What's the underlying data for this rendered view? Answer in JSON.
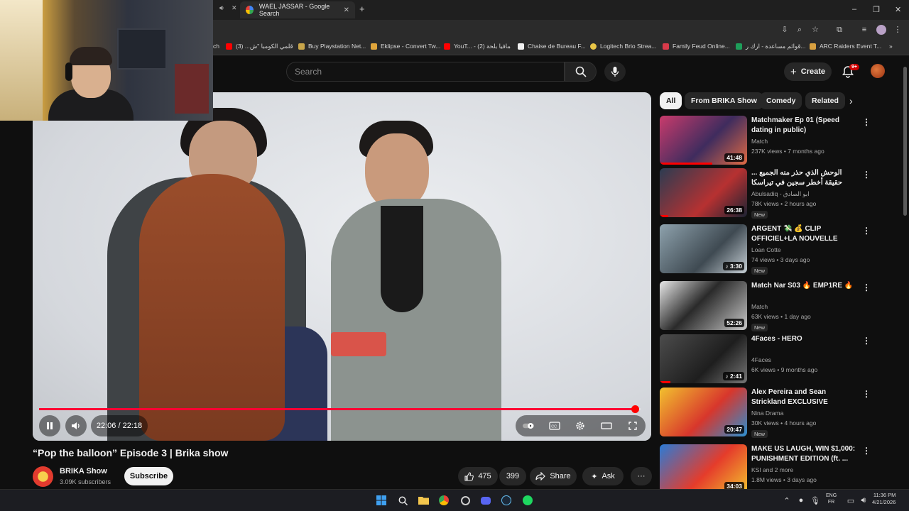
{
  "browser": {
    "active_tab_title": "WAEL JASSAR - Google Search",
    "new_tab_symbol": "+",
    "window_controls": {
      "minimize": "–",
      "restore": "❐",
      "close": "✕"
    },
    "bookmarks": [
      {
        "label": "ch",
        "icon_color": "#2b2b2b"
      },
      {
        "label": "قلمي الكومبا \"ش... (3)",
        "icon_color": "#ff0000"
      },
      {
        "label": "Buy Playstation Net...",
        "icon_color": "#c8a54a"
      },
      {
        "label": "Eklipse - Convert Tw...",
        "icon_color": "#e0a53b"
      },
      {
        "label": "YouT... - مافيا بلحة (2)",
        "icon_color": "#ff0000"
      },
      {
        "label": "Chaise de Bureau F...",
        "icon_color": "#f1f1f1"
      },
      {
        "label": "Logitech Brio Strea...",
        "icon_color": "#e8c547"
      },
      {
        "label": "Family Feud Online...",
        "icon_color": "#d83a4a"
      },
      {
        "label": "قوائم مساعدة - ارك ر...",
        "icon_color": "#1e9e5a"
      },
      {
        "label": "ARC Raiders Event T...",
        "icon_color": "#d8a040"
      }
    ],
    "bookmarks_overflow": "»"
  },
  "youtube": {
    "search_placeholder": "Search",
    "create_label": "Create",
    "notification_count": "9+",
    "player": {
      "current_time": "22:06",
      "duration": "22:18",
      "progress_fraction": 0.99
    },
    "video": {
      "title": "“Pop the balloon” Episode 3 | Brika show",
      "channel": "BRIKA Show",
      "subscribers": "3.09K subscribers",
      "subscribe_label": "Subscribe",
      "likes": "475",
      "dislikes": "399",
      "share_label": "Share",
      "ask_label": "Ask",
      "more_label": "···"
    },
    "chips": [
      "All",
      "From BRIKA Show",
      "Comedy",
      "Related"
    ],
    "recommendations": [
      {
        "title": "Matchmaker Ep 01 (Speed dating in public)",
        "channel": "Match",
        "meta": "237K views • 7 months ago",
        "duration": "41:48",
        "new": false,
        "thumb": "linear-gradient(135deg,#c93b6c,#3f2c5e 55%,#e06a44)",
        "watched": 0.6
      },
      {
        "title": "الوحش الذي حذر منه الجميع ... حقيقة أخطر سجين في تيراسكا الامريكية",
        "channel": "Abulsadiq - ابو الصادق",
        "meta": "78K views • 2 hours ago",
        "duration": "26:38",
        "new": true,
        "thumb": "linear-gradient(135deg,#2b3c52,#b73131 60%,#1b2333)",
        "watched": 0.1
      },
      {
        "title": "ARGENT 💸 💰 CLIP OFFICIEL+LA NOUVELLE SÉRIE",
        "channel": "Loan Cotte",
        "meta": "74 views • 3 days ago",
        "duration": "♪ 3:30",
        "new": true,
        "thumb": "linear-gradient(135deg,#8ea2ad,#3f4a52 60%,#c7d0d6)",
        "watched": 0
      },
      {
        "title": "Match Nar S03 🔥 EMP1RE 🔥",
        "channel": "Match",
        "meta": "63K views • 1 day ago",
        "duration": "52:26",
        "new": true,
        "thumb": "linear-gradient(135deg,#e8e8e8,#2a2a2a 45%,#c9c9c9)",
        "watched": 0
      },
      {
        "title": "4Faces - HERO",
        "channel": "4Faces",
        "meta": "6K views • 9 months ago",
        "duration": "♪ 2:41",
        "new": false,
        "thumb": "linear-gradient(135deg,#4c4c4c,#1e1e1e 60%,#777)",
        "watched": 0.12
      },
      {
        "title": "Alex Pereira and Sean Strickland EXCLUSIVE sparrin...",
        "channel": "Nina Drama",
        "meta": "30K views • 4 hours ago",
        "duration": "20:47",
        "new": true,
        "thumb": "linear-gradient(135deg,#f2c12e,#d8362c 55%,#2b8fd0)",
        "watched": 0
      },
      {
        "title": "MAKE US LAUGH, WIN $1,000: PUNISHMENT EDITION (ft. ...",
        "channel": "KSI and 2 more",
        "meta": "1.8M views • 3 days ago",
        "duration": "34:03",
        "new": false,
        "thumb": "linear-gradient(135deg,#2b7bd6,#e53c2b 55%,#f2c12e)",
        "watched": 0
      }
    ]
  },
  "taskbar": {
    "lang_top": "ENG",
    "lang_bottom": "FR",
    "time": "11:36 PM",
    "date": "4/21/2026"
  }
}
